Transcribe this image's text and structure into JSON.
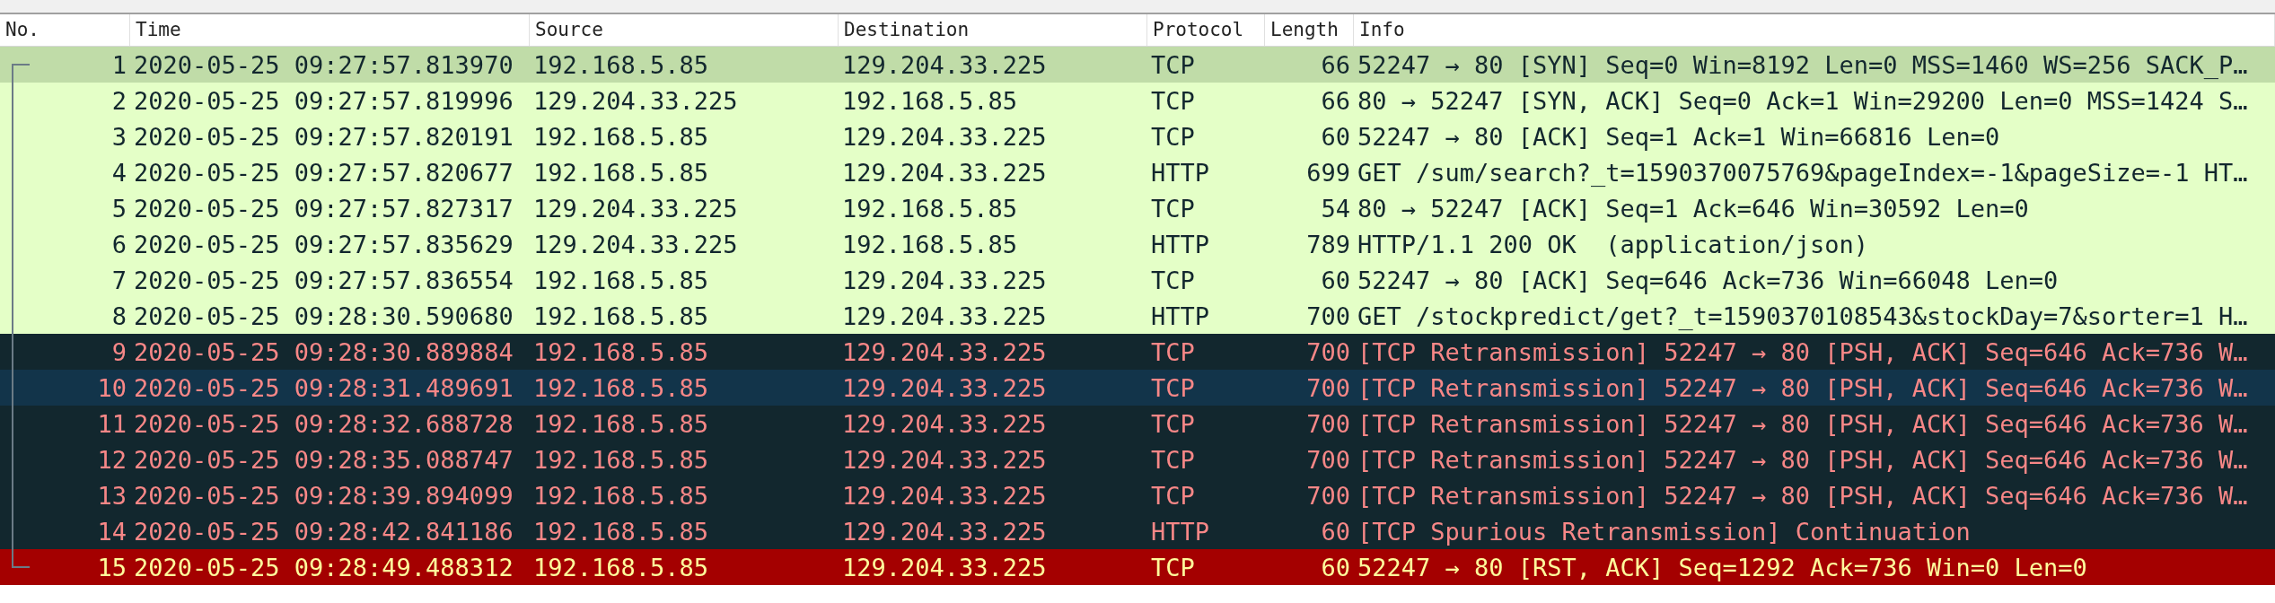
{
  "columns": [
    "No.",
    "Time",
    "Source",
    "Destination",
    "Protocol",
    "Length",
    "Info"
  ],
  "rows": [
    {
      "no": "1",
      "time": "2020-05-25 09:27:57.813970",
      "source": "192.168.5.85",
      "destination": "129.204.33.225",
      "protocol": "TCP",
      "length": "66",
      "info": "52247 → 80 [SYN] Seq=0 Win=8192 Len=0 MSS=1460 WS=256 SACK_P…",
      "kind": "normal",
      "highlighted": true,
      "bracket_start": true,
      "bracket_end": false
    },
    {
      "no": "2",
      "time": "2020-05-25 09:27:57.819996",
      "source": "129.204.33.225",
      "destination": "192.168.5.85",
      "protocol": "TCP",
      "length": "66",
      "info": "80 → 52247 [SYN, ACK] Seq=0 Ack=1 Win=29200 Len=0 MSS=1424 S…",
      "kind": "normal",
      "highlighted": false,
      "bracket_start": false,
      "bracket_end": false
    },
    {
      "no": "3",
      "time": "2020-05-25 09:27:57.820191",
      "source": "192.168.5.85",
      "destination": "129.204.33.225",
      "protocol": "TCP",
      "length": "60",
      "info": "52247 → 80 [ACK] Seq=1 Ack=1 Win=66816 Len=0",
      "kind": "normal",
      "highlighted": false,
      "bracket_start": false,
      "bracket_end": false
    },
    {
      "no": "4",
      "time": "2020-05-25 09:27:57.820677",
      "source": "192.168.5.85",
      "destination": "129.204.33.225",
      "protocol": "HTTP",
      "length": "699",
      "info": "GET /sum/search?_t=1590370075769&pageIndex=-1&pageSize=-1 HT…",
      "kind": "normal",
      "highlighted": false,
      "bracket_start": false,
      "bracket_end": false
    },
    {
      "no": "5",
      "time": "2020-05-25 09:27:57.827317",
      "source": "129.204.33.225",
      "destination": "192.168.5.85",
      "protocol": "TCP",
      "length": "54",
      "info": "80 → 52247 [ACK] Seq=1 Ack=646 Win=30592 Len=0",
      "kind": "normal",
      "highlighted": false,
      "bracket_start": false,
      "bracket_end": false
    },
    {
      "no": "6",
      "time": "2020-05-25 09:27:57.835629",
      "source": "129.204.33.225",
      "destination": "192.168.5.85",
      "protocol": "HTTP",
      "length": "789",
      "info": "HTTP/1.1 200 OK  (application/json)",
      "kind": "normal",
      "highlighted": false,
      "bracket_start": false,
      "bracket_end": false
    },
    {
      "no": "7",
      "time": "2020-05-25 09:27:57.836554",
      "source": "192.168.5.85",
      "destination": "129.204.33.225",
      "protocol": "TCP",
      "length": "60",
      "info": "52247 → 80 [ACK] Seq=646 Ack=736 Win=66048 Len=0",
      "kind": "normal",
      "highlighted": false,
      "bracket_start": false,
      "bracket_end": false
    },
    {
      "no": "8",
      "time": "2020-05-25 09:28:30.590680",
      "source": "192.168.5.85",
      "destination": "129.204.33.225",
      "protocol": "HTTP",
      "length": "700",
      "info": "GET /stockpredict/get?_t=1590370108543&stockDay=7&sorter=1 H…",
      "kind": "normal",
      "highlighted": false,
      "bracket_start": false,
      "bracket_end": false
    },
    {
      "no": "9",
      "time": "2020-05-25 09:28:30.889884",
      "source": "192.168.5.85",
      "destination": "129.204.33.225",
      "protocol": "TCP",
      "length": "700",
      "info": "[TCP Retransmission] 52247 → 80 [PSH, ACK] Seq=646 Ack=736 W…",
      "kind": "bad",
      "highlighted": false,
      "bracket_start": false,
      "bracket_end": false
    },
    {
      "no": "10",
      "time": "2020-05-25 09:28:31.489691",
      "source": "192.168.5.85",
      "destination": "129.204.33.225",
      "protocol": "TCP",
      "length": "700",
      "info": "[TCP Retransmission] 52247 → 80 [PSH, ACK] Seq=646 Ack=736 W…",
      "kind": "bad",
      "highlighted": true,
      "bracket_start": false,
      "bracket_end": false
    },
    {
      "no": "11",
      "time": "2020-05-25 09:28:32.688728",
      "source": "192.168.5.85",
      "destination": "129.204.33.225",
      "protocol": "TCP",
      "length": "700",
      "info": "[TCP Retransmission] 52247 → 80 [PSH, ACK] Seq=646 Ack=736 W…",
      "kind": "bad",
      "highlighted": false,
      "bracket_start": false,
      "bracket_end": false
    },
    {
      "no": "12",
      "time": "2020-05-25 09:28:35.088747",
      "source": "192.168.5.85",
      "destination": "129.204.33.225",
      "protocol": "TCP",
      "length": "700",
      "info": "[TCP Retransmission] 52247 → 80 [PSH, ACK] Seq=646 Ack=736 W…",
      "kind": "bad",
      "highlighted": false,
      "bracket_start": false,
      "bracket_end": false
    },
    {
      "no": "13",
      "time": "2020-05-25 09:28:39.894099",
      "source": "192.168.5.85",
      "destination": "129.204.33.225",
      "protocol": "TCP",
      "length": "700",
      "info": "[TCP Retransmission] 52247 → 80 [PSH, ACK] Seq=646 Ack=736 W…",
      "kind": "bad",
      "highlighted": false,
      "bracket_start": false,
      "bracket_end": false
    },
    {
      "no": "14",
      "time": "2020-05-25 09:28:42.841186",
      "source": "192.168.5.85",
      "destination": "129.204.33.225",
      "protocol": "HTTP",
      "length": "60",
      "info": "[TCP Spurious Retransmission] Continuation",
      "kind": "bad",
      "highlighted": false,
      "bracket_start": false,
      "bracket_end": false
    },
    {
      "no": "15",
      "time": "2020-05-25 09:28:49.488312",
      "source": "192.168.5.85",
      "destination": "129.204.33.225",
      "protocol": "TCP",
      "length": "60",
      "info": "52247 → 80 [RST, ACK] Seq=1292 Ack=736 Win=0 Len=0",
      "kind": "reset",
      "highlighted": false,
      "bracket_start": false,
      "bracket_end": true
    }
  ]
}
